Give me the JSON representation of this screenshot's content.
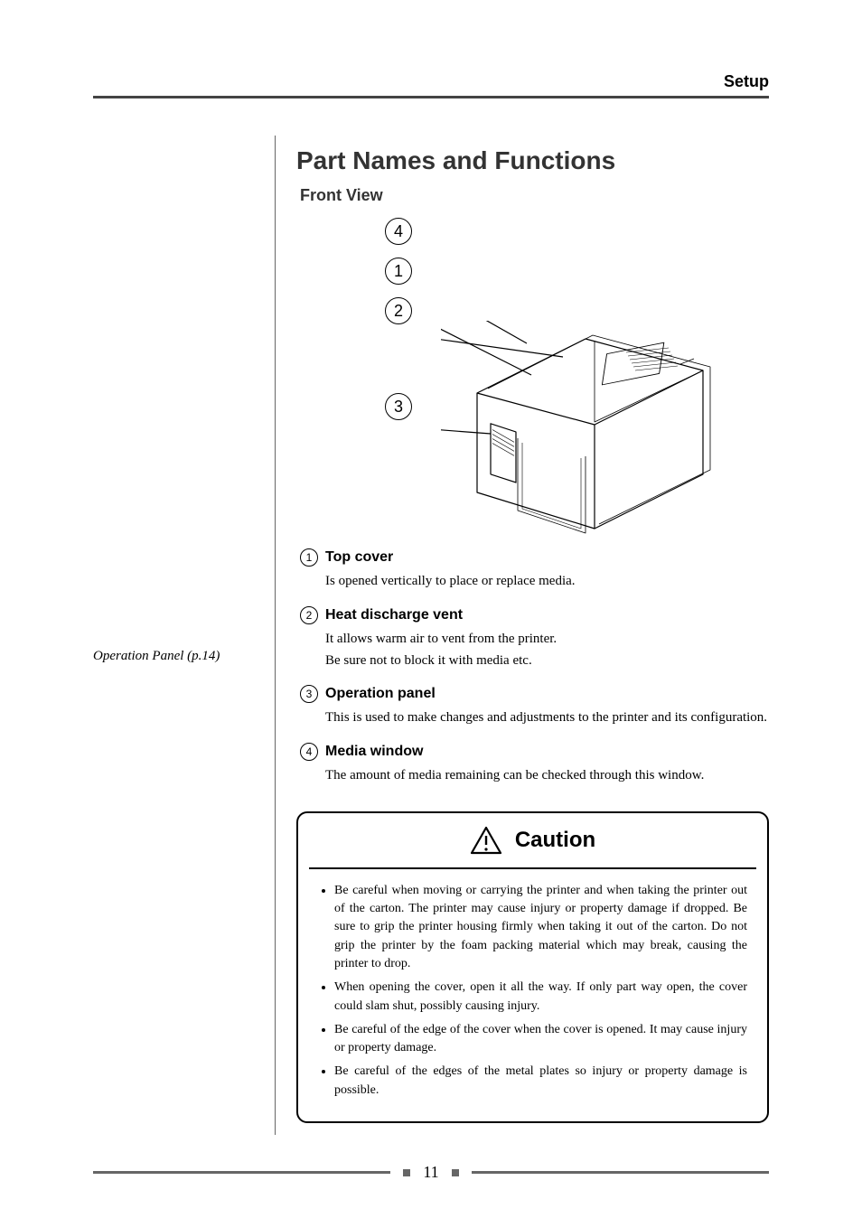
{
  "header": {
    "section": "Setup"
  },
  "title": "Part Names and Functions",
  "subtitle": "Front View",
  "callouts": {
    "c1": "4",
    "c2": "1",
    "c3": "2",
    "c4": "3"
  },
  "sidenote": "Operation Panel (p.14)",
  "items": [
    {
      "num": "1",
      "title": "Top cover",
      "body": "Is opened vertically to place or replace media."
    },
    {
      "num": "2",
      "title": "Heat discharge vent",
      "body": "It allows warm air to vent from the printer.",
      "body2": "Be sure not to block it with media etc."
    },
    {
      "num": "3",
      "title": "Operation panel",
      "body": "This is used to make changes and adjustments to the printer and its configuration."
    },
    {
      "num": "4",
      "title": "Media window",
      "body": "The amount of media remaining can be checked through this window."
    }
  ],
  "caution": {
    "title": "Caution",
    "bullets": [
      "Be careful when moving or carrying the printer and when taking the printer out of the carton. The printer may cause injury or property damage if dropped. Be sure to grip the printer housing firmly when taking it out of the carton. Do not grip the printer by the foam packing material which may break, causing the printer to drop.",
      "When opening the cover, open it all the way. If only part way open, the cover could slam shut, possibly causing injury.",
      "Be careful of the edge of the cover when the cover is opened. It may cause injury or property damage.",
      "Be careful of the edges of the metal plates so injury or property damage is possible."
    ]
  },
  "page_number": "11"
}
